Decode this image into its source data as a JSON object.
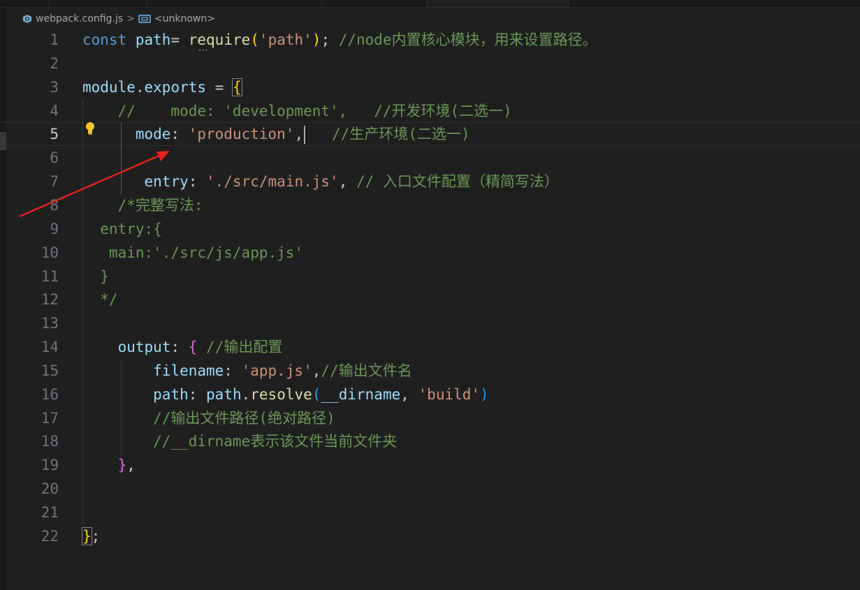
{
  "breadcrumb": {
    "file": "webpack.config.js",
    "separator": ">",
    "symbol": "<unknown>"
  },
  "lines": [
    {
      "n": "1",
      "tokens": [
        {
          "t": "const",
          "c": "kw"
        },
        {
          "t": " ",
          "c": "punc"
        },
        {
          "t": "path",
          "c": "var"
        },
        {
          "t": "= ",
          "c": "punc"
        },
        {
          "t": "require",
          "c": "fn"
        },
        {
          "t": "(",
          "c": "br1"
        },
        {
          "t": "'path'",
          "c": "str"
        },
        {
          "t": ")",
          "c": "br1"
        },
        {
          "t": "; ",
          "c": "punc"
        },
        {
          "t": "//node内置核心模块，用来设置路径。",
          "c": "cmt"
        }
      ]
    },
    {
      "n": "2",
      "tokens": []
    },
    {
      "n": "3",
      "tokens": [
        {
          "t": "module",
          "c": "var"
        },
        {
          "t": ".",
          "c": "punc"
        },
        {
          "t": "exports",
          "c": "var"
        },
        {
          "t": " = ",
          "c": "punc"
        },
        {
          "t": "{",
          "c": "br1"
        }
      ]
    },
    {
      "n": "4",
      "tokens": [
        {
          "t": "    //    mode: 'development',   //开发环境(二选一)",
          "c": "cmt"
        }
      ]
    },
    {
      "n": "5",
      "tokens": [
        {
          "t": "      ",
          "c": "punc"
        },
        {
          "t": "mode",
          "c": "prop"
        },
        {
          "t": ": ",
          "c": "punc"
        },
        {
          "t": "'production'",
          "c": "str"
        },
        {
          "t": ",",
          "c": "punc"
        }
      ],
      "caret": true,
      "tail": [
        {
          "t": "   //生产环境(二选一)",
          "c": "cmt"
        }
      ]
    },
    {
      "n": "6",
      "tokens": []
    },
    {
      "n": "7",
      "tokens": [
        {
          "t": "       ",
          "c": "punc"
        },
        {
          "t": "entry",
          "c": "prop"
        },
        {
          "t": ": ",
          "c": "punc"
        },
        {
          "t": "'./src/main.js'",
          "c": "str"
        },
        {
          "t": ", ",
          "c": "punc"
        },
        {
          "t": "// 入口文件配置（精简写法）",
          "c": "cmt"
        }
      ]
    },
    {
      "n": "8",
      "tokens": [
        {
          "t": "    /*完整写法:",
          "c": "cmt"
        }
      ]
    },
    {
      "n": "9",
      "tokens": [
        {
          "t": "  entry:{",
          "c": "cmt"
        }
      ]
    },
    {
      "n": "10",
      "tokens": [
        {
          "t": "   main:'./src/js/app.js'",
          "c": "cmt"
        }
      ]
    },
    {
      "n": "11",
      "tokens": [
        {
          "t": "  }",
          "c": "cmt"
        }
      ]
    },
    {
      "n": "12",
      "tokens": [
        {
          "t": "  */",
          "c": "cmt"
        }
      ]
    },
    {
      "n": "13",
      "tokens": []
    },
    {
      "n": "14",
      "tokens": [
        {
          "t": "    ",
          "c": "punc"
        },
        {
          "t": "output",
          "c": "prop"
        },
        {
          "t": ": ",
          "c": "punc"
        },
        {
          "t": "{",
          "c": "br2"
        },
        {
          "t": " ",
          "c": "punc"
        },
        {
          "t": "//输出配置",
          "c": "cmt"
        }
      ]
    },
    {
      "n": "15",
      "tokens": [
        {
          "t": "        ",
          "c": "punc"
        },
        {
          "t": "filename",
          "c": "prop"
        },
        {
          "t": ": ",
          "c": "punc"
        },
        {
          "t": "'app.js'",
          "c": "str"
        },
        {
          "t": ",",
          "c": "punc"
        },
        {
          "t": "//输出文件名",
          "c": "cmt"
        }
      ]
    },
    {
      "n": "16",
      "tokens": [
        {
          "t": "        ",
          "c": "punc"
        },
        {
          "t": "path",
          "c": "prop"
        },
        {
          "t": ": ",
          "c": "punc"
        },
        {
          "t": "path",
          "c": "var"
        },
        {
          "t": ".",
          "c": "punc"
        },
        {
          "t": "resolve",
          "c": "fn"
        },
        {
          "t": "(",
          "c": "br3"
        },
        {
          "t": "__dirname",
          "c": "var"
        },
        {
          "t": ", ",
          "c": "punc"
        },
        {
          "t": "'build'",
          "c": "str"
        },
        {
          "t": ")",
          "c": "br3"
        }
      ]
    },
    {
      "n": "17",
      "tokens": [
        {
          "t": "        //输出文件路径(绝对路径)",
          "c": "cmt"
        }
      ]
    },
    {
      "n": "18",
      "tokens": [
        {
          "t": "        //__dirname表示该文件当前文件夹",
          "c": "cmt"
        }
      ]
    },
    {
      "n": "19",
      "tokens": [
        {
          "t": "    ",
          "c": "punc"
        },
        {
          "t": "}",
          "c": "br2"
        },
        {
          "t": ",",
          "c": "punc"
        }
      ]
    },
    {
      "n": "20",
      "tokens": []
    },
    {
      "n": "21",
      "tokens": []
    },
    {
      "n": "22",
      "tokens": [
        {
          "t": "}",
          "c": "br1"
        },
        {
          "t": ";",
          "c": "punc"
        }
      ]
    }
  ],
  "active_line": "5",
  "icons": {
    "file": "webpack-file-icon",
    "symbol": "symbol-variable-icon",
    "lightbulb": "lightbulb-icon",
    "annotation": "red-arrow-annotation"
  },
  "colors": {
    "annotation_arrow": "#e8221b",
    "lightbulb": "#f4c430"
  }
}
